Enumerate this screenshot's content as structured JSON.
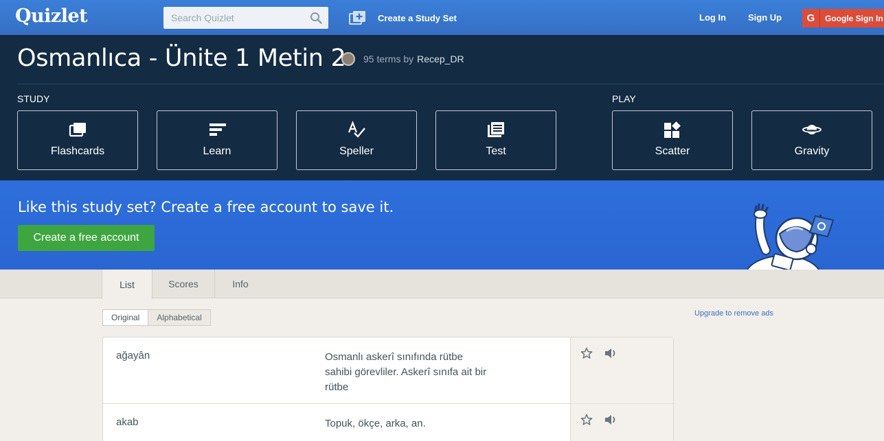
{
  "topbar": {
    "logo": "Quizlet",
    "search_placeholder": "Search Quizlet",
    "create_set_label": "Create a Study Set",
    "login_label": "Log In",
    "signup_label": "Sign Up",
    "google_label": "Google Sign In",
    "google_icon_letter": "G"
  },
  "set": {
    "title": "Osmanlıca - Ünite 1 Metin 2",
    "terms_by": "95 terms by",
    "username": "Recep_DR"
  },
  "study": {
    "label": "STUDY",
    "modes": [
      {
        "label": "Flashcards",
        "icon": "flashcards-icon"
      },
      {
        "label": "Learn",
        "icon": "learn-icon"
      },
      {
        "label": "Speller",
        "icon": "speller-icon"
      },
      {
        "label": "Test",
        "icon": "test-icon"
      }
    ]
  },
  "play": {
    "label": "PLAY",
    "modes": [
      {
        "label": "Scatter",
        "icon": "scatter-icon"
      },
      {
        "label": "Gravity",
        "icon": "gravity-icon"
      }
    ]
  },
  "promo": {
    "text": "Like this study set? Create a free account to save it.",
    "button_label": "Create a free account"
  },
  "tabs": [
    {
      "label": "List",
      "active": true
    },
    {
      "label": "Scores",
      "active": false
    },
    {
      "label": "Info",
      "active": false
    }
  ],
  "sort": {
    "original_label": "Original",
    "alphabetical_label": "Alphabetical",
    "selected": "Original"
  },
  "upgrade_label": "Upgrade to remove ads",
  "terms": [
    {
      "word": "ağayân",
      "definition": "Osmanlı askerî sınıfında rütbe sahibi görevliler. Askerî sınıfa ait bir rütbe"
    },
    {
      "word": "akab",
      "definition": "Topuk, ökçe, arka, an."
    }
  ],
  "colors": {
    "topbar": "#3b7fd9",
    "header": "#132b43",
    "promo": "#2c6ad8",
    "promo_button": "#3fa541",
    "google": "#dd4b39",
    "page_background": "#f2efea"
  }
}
